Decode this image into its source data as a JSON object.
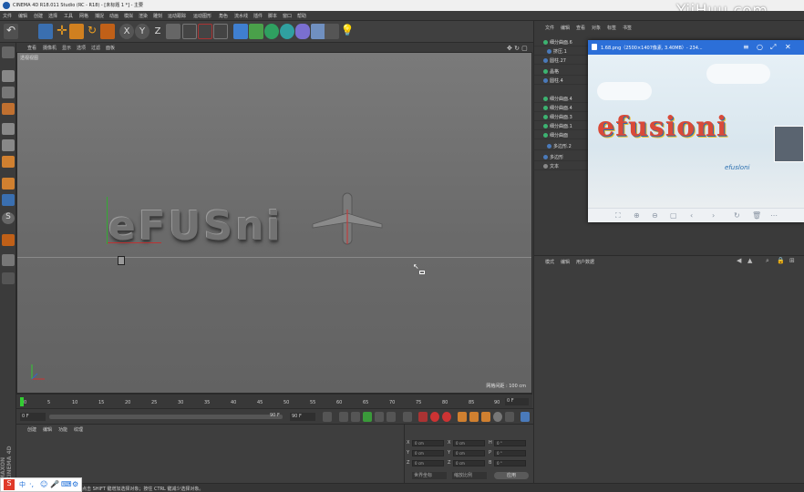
{
  "window": {
    "title": "CINEMA 4D R18.011 Studio (RC - R18) - [未标题 1 *] - 主要",
    "watermark": "YiiHuu.com"
  },
  "menu": [
    "文件",
    "编辑",
    "创建",
    "选择",
    "工具",
    "网格",
    "捕捉",
    "动画",
    "模拟",
    "渲染",
    "雕刻",
    "运动跟踪",
    "运动图形",
    "角色",
    "流水线",
    "插件",
    "脚本",
    "窗口",
    "帮助"
  ],
  "viewport": {
    "menu": [
      "查看",
      "摄像机",
      "显示",
      "选项",
      "过滤",
      "面板"
    ],
    "label": "透视视图",
    "grid_info": "网格间距 : 100 cm",
    "scene_text": "eFUSni"
  },
  "timeline": {
    "ticks": [
      "0",
      "5",
      "10",
      "15",
      "20",
      "25",
      "30",
      "35",
      "40",
      "45",
      "50",
      "55",
      "60",
      "65",
      "70",
      "75",
      "80",
      "85",
      "90"
    ],
    "frame_current": "0 F",
    "frame_start": "0 F",
    "frame_end": "90 F",
    "frame_end2": "90 F"
  },
  "attr_tabs": [
    "创建",
    "编辑",
    "功能",
    "纹理"
  ],
  "coords": {
    "rows": [
      {
        "a": "X",
        "v1": "0 cm",
        "b": "X",
        "v2": "0 cm",
        "c": "H",
        "v3": "0 °"
      },
      {
        "a": "Y",
        "v1": "0 cm",
        "b": "Y",
        "v2": "0 cm",
        "c": "P",
        "v3": "0 °"
      },
      {
        "a": "Z",
        "v1": "0 cm",
        "b": "Z",
        "v2": "0 cm",
        "c": "B",
        "v3": "0 °"
      }
    ],
    "mode1": "世界坐标",
    "mode2": "缩放比例",
    "apply": "应用"
  },
  "object_tabs": [
    "文件",
    "编辑",
    "查看",
    "对象",
    "标签",
    "书签"
  ],
  "objects": [
    "细分曲面.6",
    "挤压.1",
    "圆柱.27",
    "晶格",
    "圆柱.4",
    "细分曲面.4",
    "细分曲面.4",
    "细分曲面.3",
    "细分曲面.1",
    "细分曲面",
    "多边形.2",
    "多边形",
    "文本"
  ],
  "image_viewer": {
    "title": "1.68.png（2500×1407像素, 3.40MB）- 234...",
    "art_text": "efusioni",
    "art_sub": "efusloni"
  },
  "props_tabs": [
    "模式",
    "编辑",
    "用户数据"
  ],
  "status": "点击 SHIFT 键增加选择对象；按住 CTRL 键减少选择对象。",
  "brand_side": "MAXON CINEMA 4D"
}
